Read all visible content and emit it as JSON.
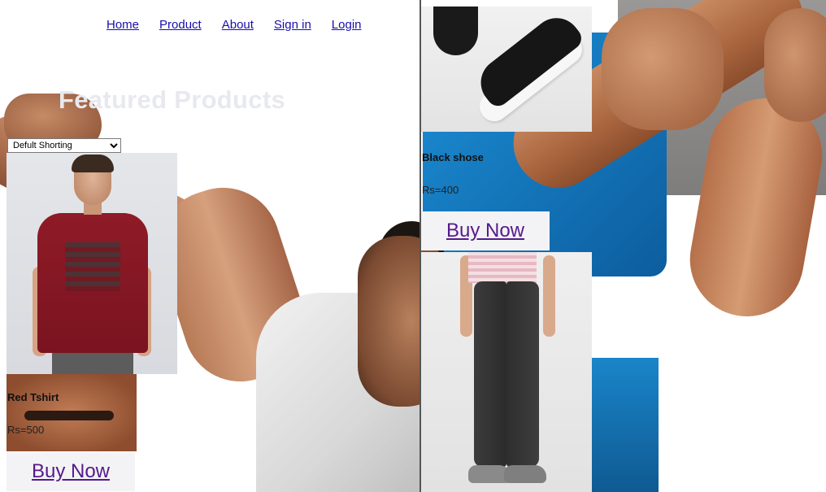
{
  "nav": {
    "items": [
      {
        "label": "Home"
      },
      {
        "label": "Product"
      },
      {
        "label": "About"
      },
      {
        "label": "Sign in"
      },
      {
        "label": "Login"
      }
    ]
  },
  "section": {
    "heading": "Featured Products"
  },
  "sort": {
    "selected": "Defult Shorting"
  },
  "products": [
    {
      "name": "Red Tshirt",
      "price": "Rs=500",
      "button": "Buy Now"
    },
    {
      "name": "Black shose",
      "price": "Rs=400",
      "button": "Buy Now"
    },
    {
      "name": "",
      "price": "",
      "button": ""
    }
  ],
  "colors": {
    "link": "#1a0dab",
    "visited_link": "#551a8b",
    "button_bg": "#f3f3f5"
  }
}
